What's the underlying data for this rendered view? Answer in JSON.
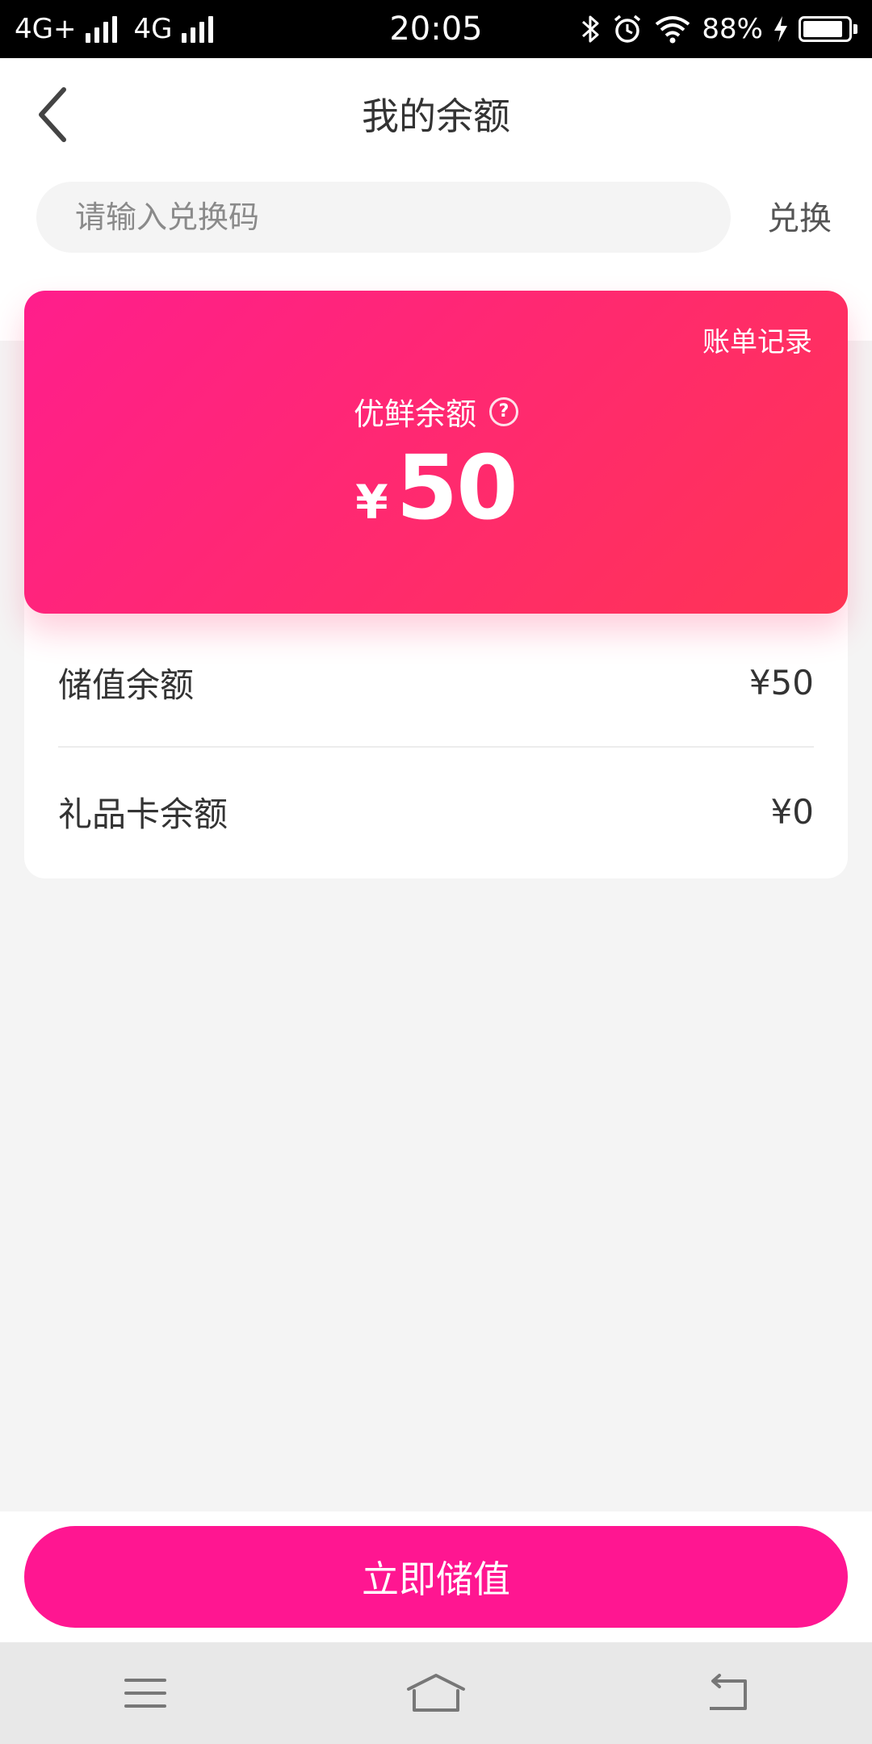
{
  "status_bar": {
    "network_1": "4G+",
    "network_2": "4G",
    "time": "20:05",
    "battery_percent": "88%",
    "battery_level": 0.88,
    "icons": [
      "bluetooth-icon",
      "alarm-icon",
      "wifi-icon",
      "charging-icon",
      "battery-icon"
    ]
  },
  "header": {
    "title": "我的余额",
    "back_icon": "chevron-left-icon"
  },
  "redeem": {
    "placeholder": "请输入兑换码",
    "value": "",
    "button_label": "兑换"
  },
  "balance_card": {
    "bill_link": "账单记录",
    "label": "优鲜余额",
    "help_icon": "question-circle-icon",
    "currency": "¥",
    "amount": "50",
    "gradient_colors": [
      "#ff1e8c",
      "#ff3454"
    ]
  },
  "rows": [
    {
      "label": "储值余额",
      "value": "¥50"
    },
    {
      "label": "礼品卡余额",
      "value": "¥0"
    }
  ],
  "recharge_button": {
    "label": "立即储值",
    "color": "#ff1691"
  },
  "nav_bar": {
    "icons": [
      "menu-icon",
      "home-icon",
      "back-icon"
    ]
  }
}
